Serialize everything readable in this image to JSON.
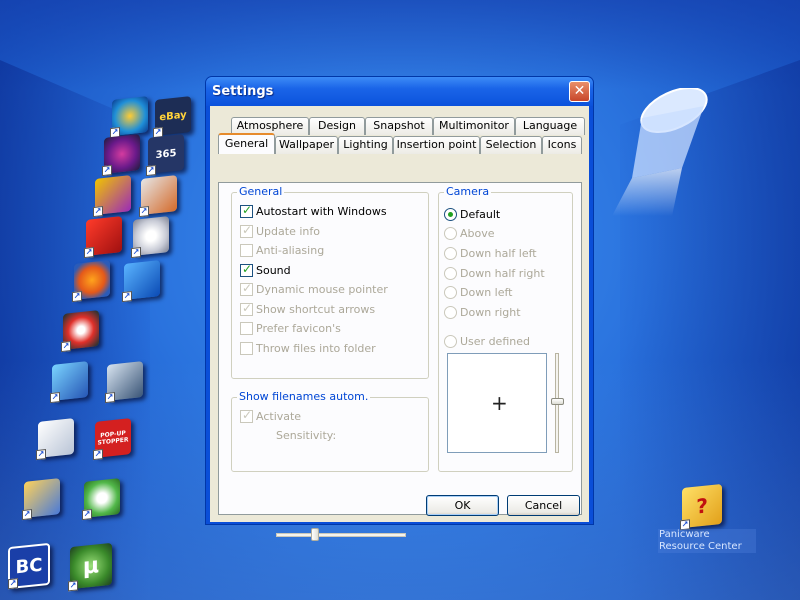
{
  "dialog": {
    "title": "Settings",
    "close_glyph": "✕",
    "tabs_top": [
      "Atmosphere",
      "Design",
      "Snapshot",
      "Multimonitor",
      "Language"
    ],
    "tabs_bottom": [
      "General",
      "Wallpaper",
      "Lighting",
      "Insertion point",
      "Selection",
      "Icons"
    ],
    "active_tab": "General",
    "general_group": {
      "label": "General",
      "items": [
        {
          "label": "Autostart with Windows",
          "checked": true,
          "enabled": true
        },
        {
          "label": "Update info",
          "checked": true,
          "enabled": false
        },
        {
          "label": "Anti-aliasing",
          "checked": false,
          "enabled": false
        },
        {
          "label": "Sound",
          "checked": true,
          "enabled": true
        },
        {
          "label": "Dynamic mouse pointer",
          "checked": true,
          "enabled": false
        },
        {
          "label": "Show shortcut arrows",
          "checked": true,
          "enabled": false
        },
        {
          "label": "Prefer favicon's",
          "checked": false,
          "enabled": false
        },
        {
          "label": "Throw files into folder",
          "checked": false,
          "enabled": false
        }
      ]
    },
    "filenames_group": {
      "label": "Show filenames autom.",
      "activate_label": "Activate",
      "activate_checked": true,
      "sensitivity_label": "Sensitivity:"
    },
    "camera_group": {
      "label": "Camera",
      "options": [
        {
          "label": "Default",
          "selected": true,
          "enabled": true
        },
        {
          "label": "Above",
          "selected": false,
          "enabled": false
        },
        {
          "label": "Down half left",
          "selected": false,
          "enabled": false
        },
        {
          "label": "Down half right",
          "selected": false,
          "enabled": false
        },
        {
          "label": "Down left",
          "selected": false,
          "enabled": false
        },
        {
          "label": "Down right",
          "selected": false,
          "enabled": false
        },
        {
          "label": "User defined",
          "selected": false,
          "enabled": false
        }
      ],
      "crosshair_glyph": "+"
    },
    "ok_label": "OK",
    "cancel_label": "Cancel"
  },
  "desktop": {
    "shortcut_arrow_glyph": "↗",
    "icon_texts": {
      "ebay": "eBay",
      "calendar": "365",
      "popup_stopper": "POP-UP STOPPER",
      "bc": "BC",
      "utorrent": "µ",
      "panicware": "?"
    },
    "panicware_label": "Panicware Resource Center"
  },
  "colors": {
    "title_bar": "#0b52dc",
    "dialog_face": "#ece9d8",
    "group_label": "#0046d5",
    "check_green": "#21a121",
    "desktop_blue": "#2a73de"
  }
}
